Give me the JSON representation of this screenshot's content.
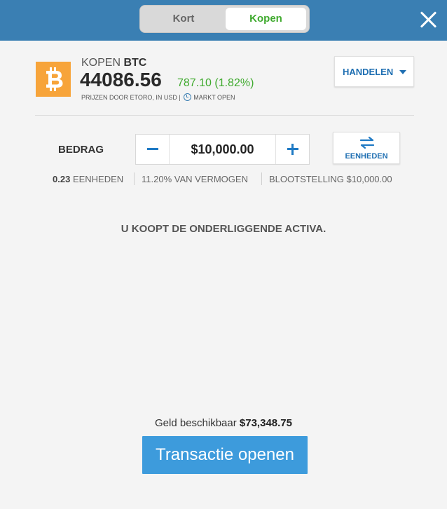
{
  "toggle": {
    "short_label": "Kort",
    "buy_label": "Kopen",
    "active": "buy"
  },
  "asset": {
    "action": "KOPEN",
    "ticker": "BTC",
    "price": "44086.56",
    "change": "787.10 (1.82%)",
    "prices_by": "PRIJZEN DOOR ETORO, IN USD |",
    "market_status": "MARKT OPEN",
    "logo_icon": "bitcoin-icon",
    "logo_color": "#f7a43a"
  },
  "trade_dropdown": {
    "label": "HANDELEN"
  },
  "amount": {
    "label": "BEDRAG",
    "value": "$10,000.00",
    "units_button_label": "EENHEDEN"
  },
  "stats": {
    "units_value": "0.23",
    "units_label": "EENHEDEN",
    "equity": "11.20% VAN VERMOGEN",
    "exposure": "BLOOTSTELLING $10,000.00"
  },
  "notice": "U KOOPT DE ONDERLIGGENDE ACTIVA.",
  "footer": {
    "available_label": "Geld beschikbaar",
    "available_value": "$73,348.75",
    "open_button": "Transactie openen"
  },
  "colors": {
    "header": "#3a7fb3",
    "buy_green": "#3faa2e",
    "link_blue": "#1f6fb2",
    "primary_button": "#3d9bdc"
  }
}
